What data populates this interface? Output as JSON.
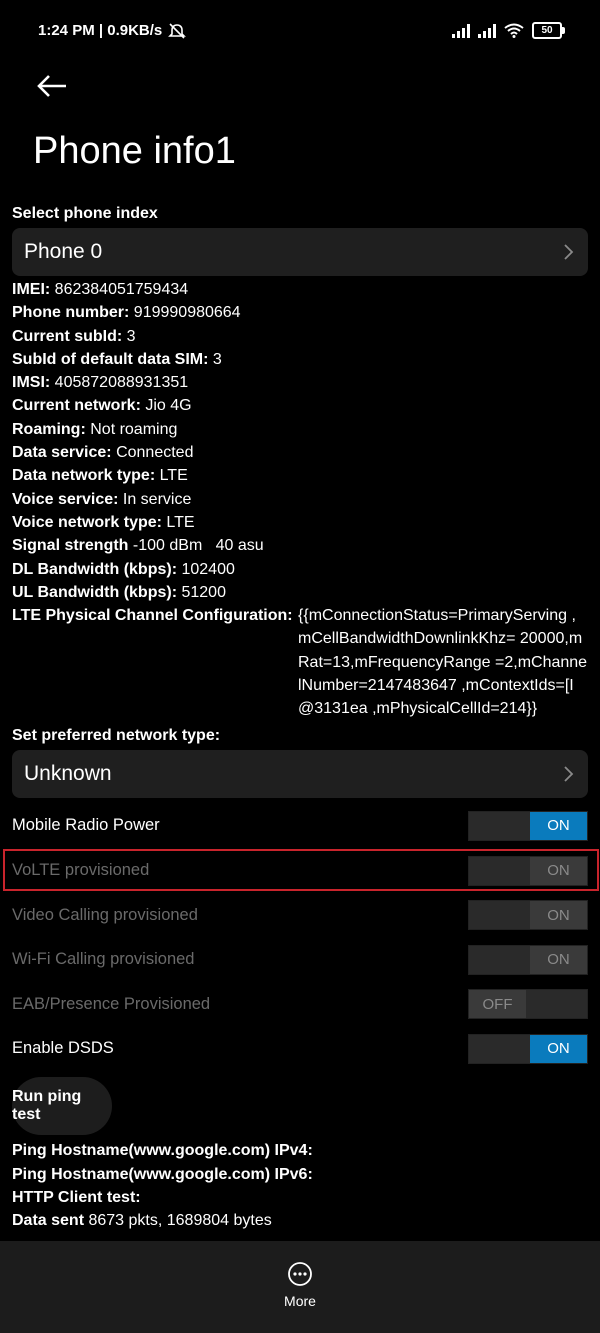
{
  "status": {
    "time_speed": "1:24 PM | 0.9KB/s",
    "battery": "50"
  },
  "page": {
    "title": "Phone info1"
  },
  "phone_index": {
    "label": "Select phone index",
    "value": "Phone 0"
  },
  "info": [
    {
      "k": "IMEI:",
      "v": "862384051759434"
    },
    {
      "k": "Phone number:",
      "v": "919990980664"
    },
    {
      "k": "Current subId:",
      "v": "3"
    },
    {
      "k": "SubId of default data SIM:",
      "v": "3"
    },
    {
      "k": "IMSI:",
      "v": "405872088931351"
    },
    {
      "k": "Current network:",
      "v": "Jio 4G"
    },
    {
      "k": "Roaming:",
      "v": "Not roaming"
    },
    {
      "k": "Data service:",
      "v": "Connected"
    },
    {
      "k": "Data network type:",
      "v": "LTE"
    },
    {
      "k": "Voice service:",
      "v": "In service"
    },
    {
      "k": "Voice network type:",
      "v": "LTE"
    },
    {
      "k": "Signal strength",
      "v": "-100 dBm   40 asu"
    },
    {
      "k": "DL Bandwidth (kbps):",
      "v": "102400"
    },
    {
      "k": "UL Bandwidth (kbps):",
      "v": "51200"
    }
  ],
  "lte": {
    "k": "LTE Physical Channel Configuration:",
    "v": "{{mConnectionStatus=PrimaryServing ,mCellBandwidthDownlinkKhz= 20000,mRat=13,mFrequencyRange =2,mChannelNumber=2147483647 ,mContextIds=[I@3131ea ,mPhysicalCellId=214}}"
  },
  "network_type": {
    "label": "Set preferred network type:",
    "value": "Unknown"
  },
  "toggles": [
    {
      "label": "Mobile Radio Power",
      "state": "ON",
      "enabled": true
    },
    {
      "label": "VoLTE provisioned",
      "state": "ON",
      "enabled": false
    },
    {
      "label": "Video Calling provisioned",
      "state": "ON",
      "enabled": false
    },
    {
      "label": "Wi-Fi Calling provisioned",
      "state": "ON",
      "enabled": false
    },
    {
      "label": "EAB/Presence Provisioned",
      "state": "OFF",
      "enabled": false
    },
    {
      "label": "Enable DSDS",
      "state": "ON",
      "enabled": true
    }
  ],
  "ping": {
    "button": "Run ping test",
    "lines": [
      {
        "k": "Ping Hostname(www.google.com) IPv4:",
        "v": ""
      },
      {
        "k": "Ping Hostname(www.google.com) IPv6:",
        "v": ""
      },
      {
        "k": "HTTP Client test:",
        "v": ""
      },
      {
        "k": "Data sent",
        "v": "8673 pkts, 1689804 bytes"
      }
    ]
  },
  "bottom": {
    "more_label": "More"
  },
  "colors": {
    "accent": "#0a7bbd",
    "highlight": "#c9242c"
  }
}
